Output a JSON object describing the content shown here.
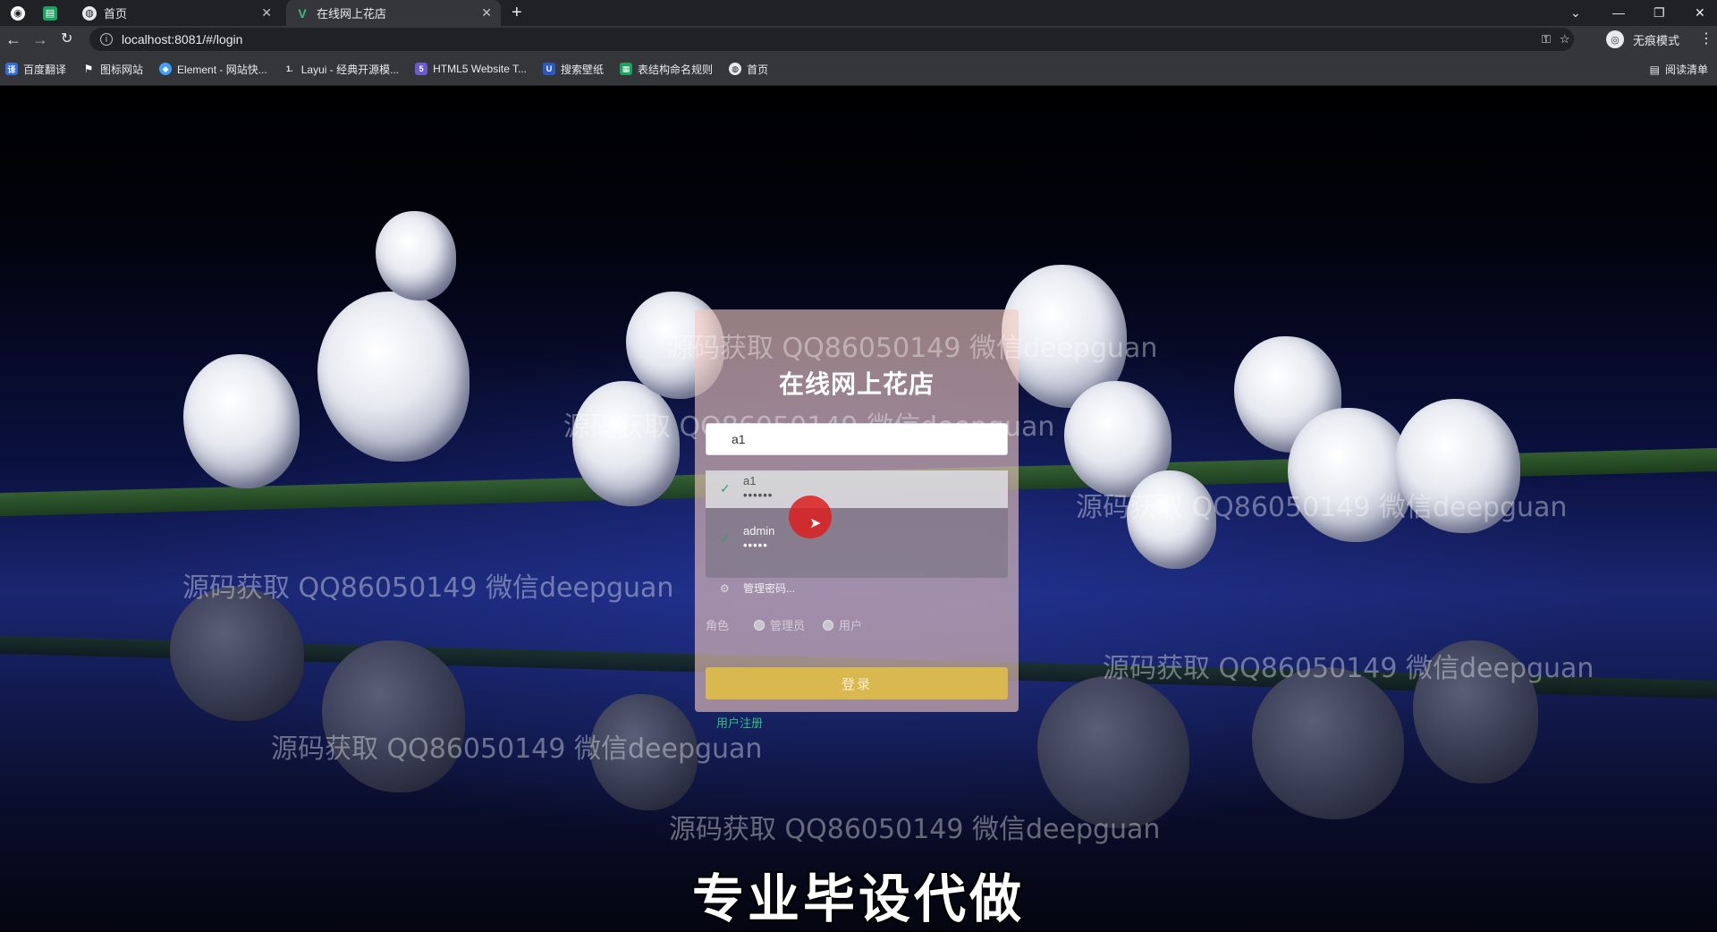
{
  "browser": {
    "tabs": [
      {
        "label": "",
        "icon": "browser-logo-icon"
      },
      {
        "label": "",
        "icon": "sheet-icon"
      },
      {
        "label": "首页",
        "icon": "globe-icon"
      },
      {
        "label": "在线网上花店",
        "icon": "vue-icon",
        "active": true
      }
    ],
    "new_tab": "+",
    "url": "localhost:8081/#/login",
    "incognito_label": "无痕模式",
    "reading_list": "阅读清单",
    "bookmarks": [
      {
        "label": "百度翻译",
        "icon": "baidu-translate-icon",
        "color": "#2f6de1"
      },
      {
        "label": "图标网站",
        "icon": "flag-icon",
        "color": "#555555"
      },
      {
        "label": "Element - 网站快...",
        "icon": "element-icon",
        "color": "#409eff"
      },
      {
        "label": "Layui - 经典开源模...",
        "icon": "layui-icon",
        "color": "#5fb878"
      },
      {
        "label": "HTML5 Website T...",
        "icon": "html5-icon",
        "color": "#6a5acd"
      },
      {
        "label": "搜索壁纸",
        "icon": "wallpaper-icon",
        "color": "#2b59c3"
      },
      {
        "label": "表结构命名规则",
        "icon": "table-icon",
        "color": "#1aa260"
      },
      {
        "label": "首页",
        "icon": "globe-icon",
        "color": "#888888"
      }
    ]
  },
  "login": {
    "title": "在线网上花店",
    "username_value": "a1",
    "autocomplete": [
      {
        "user": "a1",
        "password": "••••••"
      },
      {
        "user": "admin",
        "password": "•••••"
      }
    ],
    "manage_passwords": "管理密码...",
    "role_label": "角色",
    "roles": [
      "管理员",
      "用户"
    ],
    "submit": "登录",
    "register": "用户注册"
  },
  "watermark_text": "源码获取 QQ86050149 微信deepguan",
  "caption": "专业毕设代做",
  "colors": {
    "login_button": "#d9b94f",
    "register_link": "#2bbf8a"
  }
}
